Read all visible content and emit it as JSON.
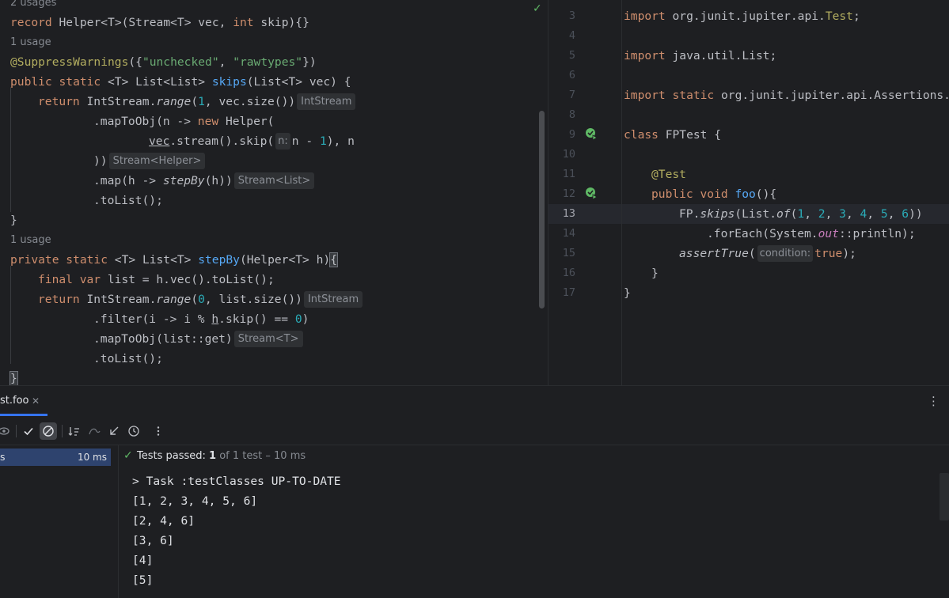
{
  "left_editor": {
    "lines": [
      {
        "kind": "hint",
        "text": "2 usages"
      },
      {
        "kind": "code",
        "tokens": [
          {
            "t": "record ",
            "c": "kw"
          },
          {
            "t": "Helper<",
            "c": ""
          },
          {
            "t": "T",
            "c": ""
          },
          {
            "t": ">(Stream<T> vec, ",
            "c": ""
          },
          {
            "t": "int ",
            "c": "kw"
          },
          {
            "t": "skip){}",
            "c": ""
          }
        ]
      },
      {
        "kind": "hint",
        "text": "1 usage"
      },
      {
        "kind": "code",
        "tokens": [
          {
            "t": "@SuppressWarnings",
            "c": "ann"
          },
          {
            "t": "({",
            "c": ""
          },
          {
            "t": "\"unchecked\"",
            "c": "str"
          },
          {
            "t": ", ",
            "c": ""
          },
          {
            "t": "\"rawtypes\"",
            "c": "str"
          },
          {
            "t": "})",
            "c": ""
          }
        ]
      },
      {
        "kind": "code",
        "tokens": [
          {
            "t": "public static ",
            "c": "kw"
          },
          {
            "t": "<T> List<List> ",
            "c": ""
          },
          {
            "t": "skips",
            "c": "fn"
          },
          {
            "t": "(List<T> vec) {",
            "c": ""
          }
        ]
      },
      {
        "kind": "code",
        "indent": 1,
        "tokens": [
          {
            "t": "return ",
            "c": "kw"
          },
          {
            "t": "IntStream.",
            "c": ""
          },
          {
            "t": "range",
            "c": "it"
          },
          {
            "t": "(",
            "c": ""
          },
          {
            "t": "1",
            "c": "num"
          },
          {
            "t": ", vec.size())",
            "c": ""
          },
          {
            "t": "IntStream",
            "c": "inlay"
          }
        ]
      },
      {
        "kind": "code",
        "indent": 3,
        "tokens": [
          {
            "t": ".mapToObj(n -> ",
            "c": ""
          },
          {
            "t": "new ",
            "c": "kw"
          },
          {
            "t": "Helper(",
            "c": ""
          }
        ]
      },
      {
        "kind": "code",
        "indent": 5,
        "tokens": [
          {
            "t": "vec",
            "c": "link"
          },
          {
            "t": ".stream().skip(",
            "c": ""
          },
          {
            "t": "n:",
            "c": "inlay-small"
          },
          {
            "t": "n - ",
            "c": ""
          },
          {
            "t": "1",
            "c": "num"
          },
          {
            "t": "), n",
            "c": ""
          }
        ]
      },
      {
        "kind": "code",
        "indent": 3,
        "tokens": [
          {
            "t": "))",
            "c": ""
          },
          {
            "t": "Stream<Helper>",
            "c": "inlay"
          }
        ]
      },
      {
        "kind": "code",
        "indent": 3,
        "tokens": [
          {
            "t": ".map(h -> ",
            "c": ""
          },
          {
            "t": "stepBy",
            "c": "it"
          },
          {
            "t": "(h))",
            "c": ""
          },
          {
            "t": "Stream<List>",
            "c": "inlay"
          }
        ]
      },
      {
        "kind": "code",
        "indent": 3,
        "tokens": [
          {
            "t": ".toList();",
            "c": ""
          }
        ]
      },
      {
        "kind": "code",
        "tokens": [
          {
            "t": "}",
            "c": ""
          }
        ]
      },
      {
        "kind": "hint",
        "text": "1 usage"
      },
      {
        "kind": "code",
        "tokens": [
          {
            "t": "private static ",
            "c": "kw"
          },
          {
            "t": "<T> List<T> ",
            "c": ""
          },
          {
            "t": "stepBy",
            "c": "fn"
          },
          {
            "t": "(Helper<T> h)",
            "c": ""
          },
          {
            "t": "{",
            "c": "caret"
          }
        ]
      },
      {
        "kind": "code",
        "indent": 1,
        "tokens": [
          {
            "t": "final var ",
            "c": "kw"
          },
          {
            "t": "list = h.vec().toList();",
            "c": ""
          }
        ]
      },
      {
        "kind": "code",
        "indent": 1,
        "tokens": [
          {
            "t": "return ",
            "c": "kw"
          },
          {
            "t": "IntStream.",
            "c": ""
          },
          {
            "t": "range",
            "c": "it"
          },
          {
            "t": "(",
            "c": ""
          },
          {
            "t": "0",
            "c": "num"
          },
          {
            "t": ", list.size())",
            "c": ""
          },
          {
            "t": "IntStream",
            "c": "inlay"
          }
        ]
      },
      {
        "kind": "code",
        "indent": 3,
        "tokens": [
          {
            "t": ".filter(i -> i % ",
            "c": ""
          },
          {
            "t": "h",
            "c": "link"
          },
          {
            "t": ".skip() == ",
            "c": ""
          },
          {
            "t": "0",
            "c": "num"
          },
          {
            "t": ")",
            "c": ""
          }
        ]
      },
      {
        "kind": "code",
        "indent": 3,
        "tokens": [
          {
            "t": ".mapToObj(list::get)",
            "c": ""
          },
          {
            "t": "Stream<T>",
            "c": "inlay"
          }
        ]
      },
      {
        "kind": "code",
        "indent": 3,
        "tokens": [
          {
            "t": ".toList();",
            "c": ""
          }
        ]
      },
      {
        "kind": "code",
        "tokens": [
          {
            "t": "}",
            "c": "caret"
          }
        ]
      }
    ]
  },
  "right_editor": {
    "active_line": 13,
    "run_icon_lines": [
      9,
      12
    ],
    "lines": [
      {
        "n": 3,
        "tokens": [
          {
            "t": "import ",
            "c": "kw"
          },
          {
            "t": "org.junit.jupiter.api.",
            "c": ""
          },
          {
            "t": "Test",
            "c": "ann"
          },
          {
            "t": ";",
            "c": ""
          }
        ]
      },
      {
        "n": 4,
        "tokens": []
      },
      {
        "n": 5,
        "tokens": [
          {
            "t": "import ",
            "c": "kw"
          },
          {
            "t": "java.util.List;",
            "c": ""
          }
        ]
      },
      {
        "n": 6,
        "tokens": []
      },
      {
        "n": 7,
        "tokens": [
          {
            "t": "import static ",
            "c": "kw"
          },
          {
            "t": "org.junit.jupiter.api.Assertions.",
            "c": ""
          },
          {
            "t": "*",
            "c": "ann"
          }
        ]
      },
      {
        "n": 8,
        "tokens": []
      },
      {
        "n": 9,
        "tokens": [
          {
            "t": "class ",
            "c": "kw"
          },
          {
            "t": "FPTest {",
            "c": ""
          }
        ]
      },
      {
        "n": 10,
        "tokens": []
      },
      {
        "n": 11,
        "indent": 1,
        "tokens": [
          {
            "t": "@Test",
            "c": "ann"
          }
        ]
      },
      {
        "n": 12,
        "indent": 1,
        "tokens": [
          {
            "t": "public void ",
            "c": "kw"
          },
          {
            "t": "foo",
            "c": "fn"
          },
          {
            "t": "(){",
            "c": ""
          }
        ]
      },
      {
        "n": 13,
        "indent": 2,
        "tokens": [
          {
            "t": "FP.",
            "c": ""
          },
          {
            "t": "skips",
            "c": "it"
          },
          {
            "t": "(List.",
            "c": ""
          },
          {
            "t": "of",
            "c": "it"
          },
          {
            "t": "(",
            "c": ""
          },
          {
            "t": "1",
            "c": "num"
          },
          {
            "t": ", ",
            "c": ""
          },
          {
            "t": "2",
            "c": "num"
          },
          {
            "t": ", ",
            "c": ""
          },
          {
            "t": "3",
            "c": "num"
          },
          {
            "t": ", ",
            "c": ""
          },
          {
            "t": "4",
            "c": "num"
          },
          {
            "t": ", ",
            "c": ""
          },
          {
            "t": "5",
            "c": "num"
          },
          {
            "t": ", ",
            "c": ""
          },
          {
            "t": "6",
            "c": "num"
          },
          {
            "t": "))",
            "c": ""
          }
        ]
      },
      {
        "n": 14,
        "indent": 3,
        "tokens": [
          {
            "t": ".forEach(System.",
            "c": ""
          },
          {
            "t": "out",
            "c": "field"
          },
          {
            "t": "::println);",
            "c": ""
          }
        ]
      },
      {
        "n": 15,
        "indent": 2,
        "tokens": [
          {
            "t": "assertTrue",
            "c": "it"
          },
          {
            "t": "(",
            "c": ""
          },
          {
            "t": "condition:",
            "c": "inlay-small"
          },
          {
            "t": "true",
            "c": "kw"
          },
          {
            "t": ");",
            "c": ""
          }
        ]
      },
      {
        "n": 16,
        "indent": 1,
        "tokens": [
          {
            "t": "}",
            "c": ""
          }
        ]
      },
      {
        "n": 17,
        "tokens": [
          {
            "t": "}",
            "c": ""
          }
        ]
      }
    ]
  },
  "run_panel": {
    "tab_title": "st.foo",
    "tree_label": "s",
    "tree_time": "10 ms",
    "status_prefix": "Tests passed: ",
    "status_count": "1",
    "status_suffix": " of 1 test – 10 ms",
    "console_lines": [
      "> Task :testClasses UP-TO-DATE",
      "[1, 2, 3, 4, 5, 6]",
      "[2, 4, 6]",
      "[3, 6]",
      "[4]",
      "[5]"
    ]
  }
}
